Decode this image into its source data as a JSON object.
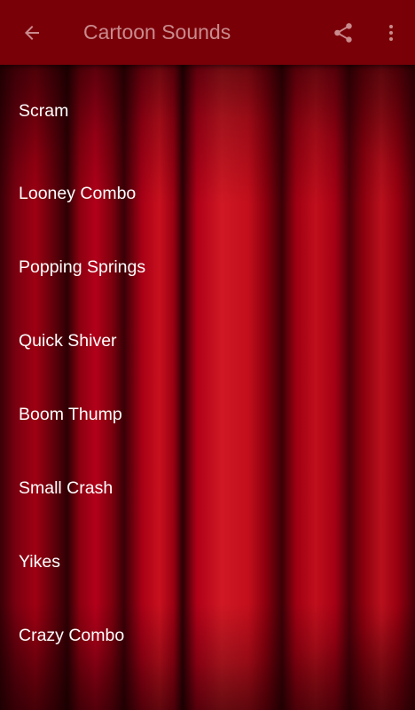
{
  "app_bar": {
    "title": "Cartoon Sounds",
    "back_icon": "arrow-left-icon",
    "share_icon": "share-icon",
    "overflow_icon": "more-vert-icon"
  },
  "colors": {
    "app_bar_bg": "#7a0008",
    "title_text": "#c98a8c",
    "item_text": "#ffffff",
    "background": "red-curtain"
  },
  "sounds": [
    {
      "label": "Scram"
    },
    {
      "label": "Looney Combo"
    },
    {
      "label": "Popping Springs"
    },
    {
      "label": "Quick Shiver"
    },
    {
      "label": "Boom Thump"
    },
    {
      "label": "Small Crash"
    },
    {
      "label": "Yikes"
    },
    {
      "label": "Crazy Combo"
    }
  ]
}
